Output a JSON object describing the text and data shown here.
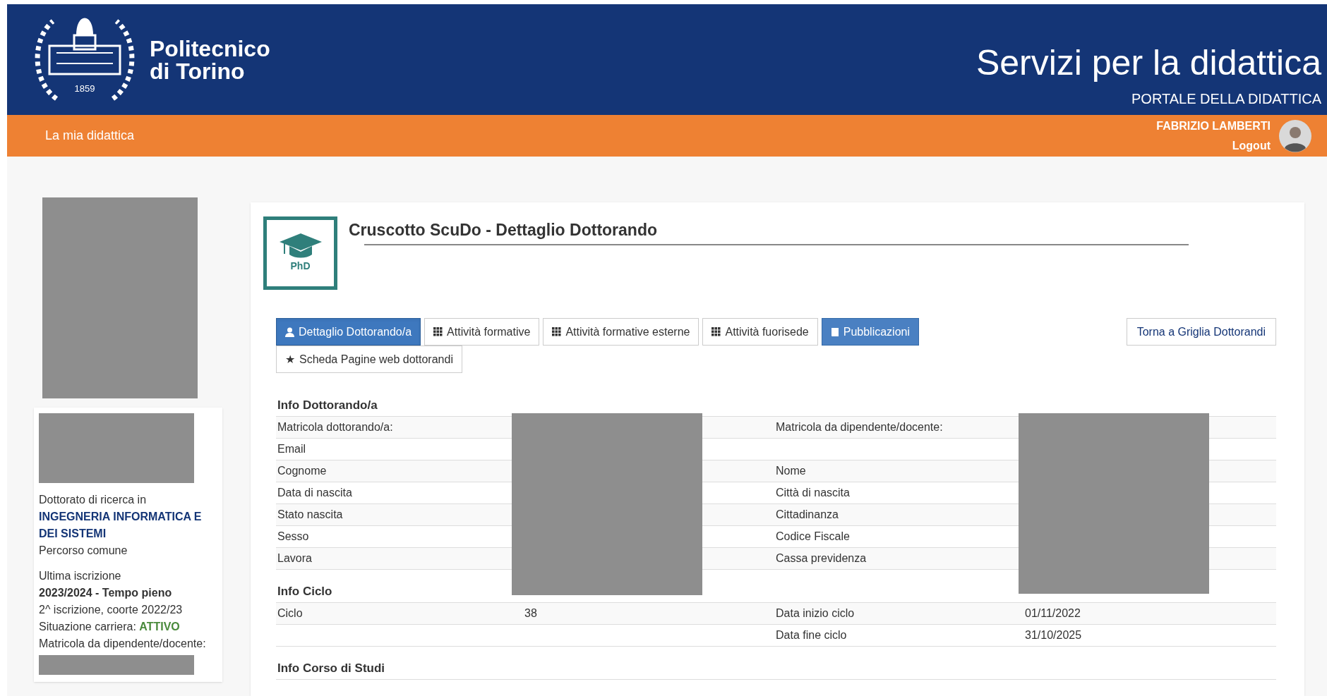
{
  "header": {
    "logo_lines": [
      "Politecnico",
      "di Torino"
    ],
    "logo_year": "1859",
    "title": "Servizi per la didattica",
    "subtitle": "PORTALE DELLA DIDATTICA"
  },
  "nav": {
    "link": "La mia didattica",
    "user_name": "FABRIZIO LAMBERTI",
    "logout": "Logout"
  },
  "sidebar": {
    "lines": [
      {
        "kind": "plain",
        "text": "Dottorato di ricerca in"
      },
      {
        "kind": "link",
        "text": "INGEGNERIA INFORMATICA E DEI SISTEMI"
      },
      {
        "kind": "plain",
        "text": "Percorso comune"
      },
      {
        "kind": "gap",
        "text": "Ultima iscrizione"
      },
      {
        "kind": "bold",
        "text": "2023/2024 - Tempo pieno"
      },
      {
        "kind": "plain",
        "text": "2^ iscrizione, coorte 2022/23"
      },
      {
        "kind": "status",
        "text": "Situazione carriera:",
        "status": "ATTIVO"
      },
      {
        "kind": "plain",
        "text": "Matricola da dipendente/docente:"
      }
    ]
  },
  "main": {
    "title": "Cruscotto ScuDo - Dettaglio Dottorando",
    "badge": "PhD",
    "tabs": [
      {
        "label": "Dettaglio Dottorando/a",
        "selected": true,
        "kind": "primary"
      },
      {
        "label": "Attività formative",
        "selected": false,
        "kind": "default"
      },
      {
        "label": "Attività formative esterne",
        "selected": false,
        "kind": "default"
      },
      {
        "label": "Attività fuorisede",
        "selected": false,
        "kind": "default"
      },
      {
        "label": "Pubblicazioni",
        "selected": false,
        "kind": "primary"
      },
      {
        "label": "Scheda Pagine web dottorandi",
        "selected": false,
        "kind": "default",
        "glyph": "★"
      }
    ],
    "back_button": "Torna a Griglia Dottorandi",
    "sections": [
      {
        "title": "Info Dottorando/a",
        "rows": [
          {
            "label_1": "Matricola dottorando/a:",
            "label_2": "Matricola da dipendente/docente:"
          },
          {
            "label_1": "Email"
          },
          {
            "label_1": "Cognome",
            "label_2": "Nome"
          },
          {
            "label_1": "Data di nascita",
            "label_2": "Città di nascita"
          },
          {
            "label_1": "Stato nascita",
            "label_2": "Cittadinanza"
          },
          {
            "label_1": "Sesso",
            "label_2": "Codice Fiscale"
          },
          {
            "label_1": "Lavora",
            "label_2": "Cassa previdenza"
          }
        ]
      },
      {
        "title": "Info Ciclo",
        "rows": [
          {
            "label_1": "Ciclo",
            "value_1": "38",
            "label_2": "Data inizio ciclo",
            "value_2": "01/11/2022"
          },
          {
            "label_2": "Data fine ciclo",
            "value_2": "31/10/2025"
          }
        ]
      },
      {
        "title": "Info Corso di Studi"
      }
    ]
  }
}
